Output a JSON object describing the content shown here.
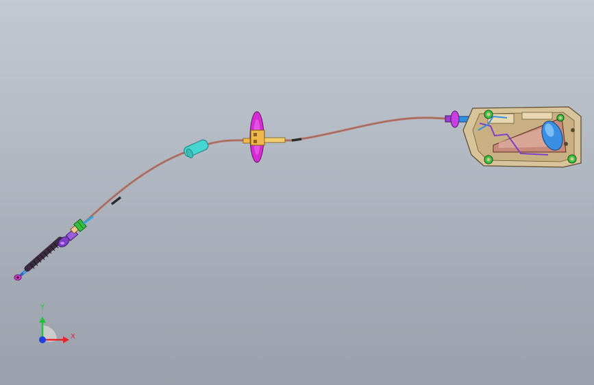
{
  "triad": {
    "x_label": "X",
    "y_label": "Y",
    "x_color": "#e8222b",
    "y_color": "#22c23a",
    "z_color": "#1f3fe0"
  },
  "model": {
    "cable_color": "#b77b6e",
    "bellows_color": "#3a2c3e",
    "sleeve_color": "#47d4d0",
    "grommet_color": "#d42bd4",
    "fitting_color": "#f0b84a",
    "housing_color": "#d8c39a",
    "knob_color": "#3a8fe3"
  }
}
